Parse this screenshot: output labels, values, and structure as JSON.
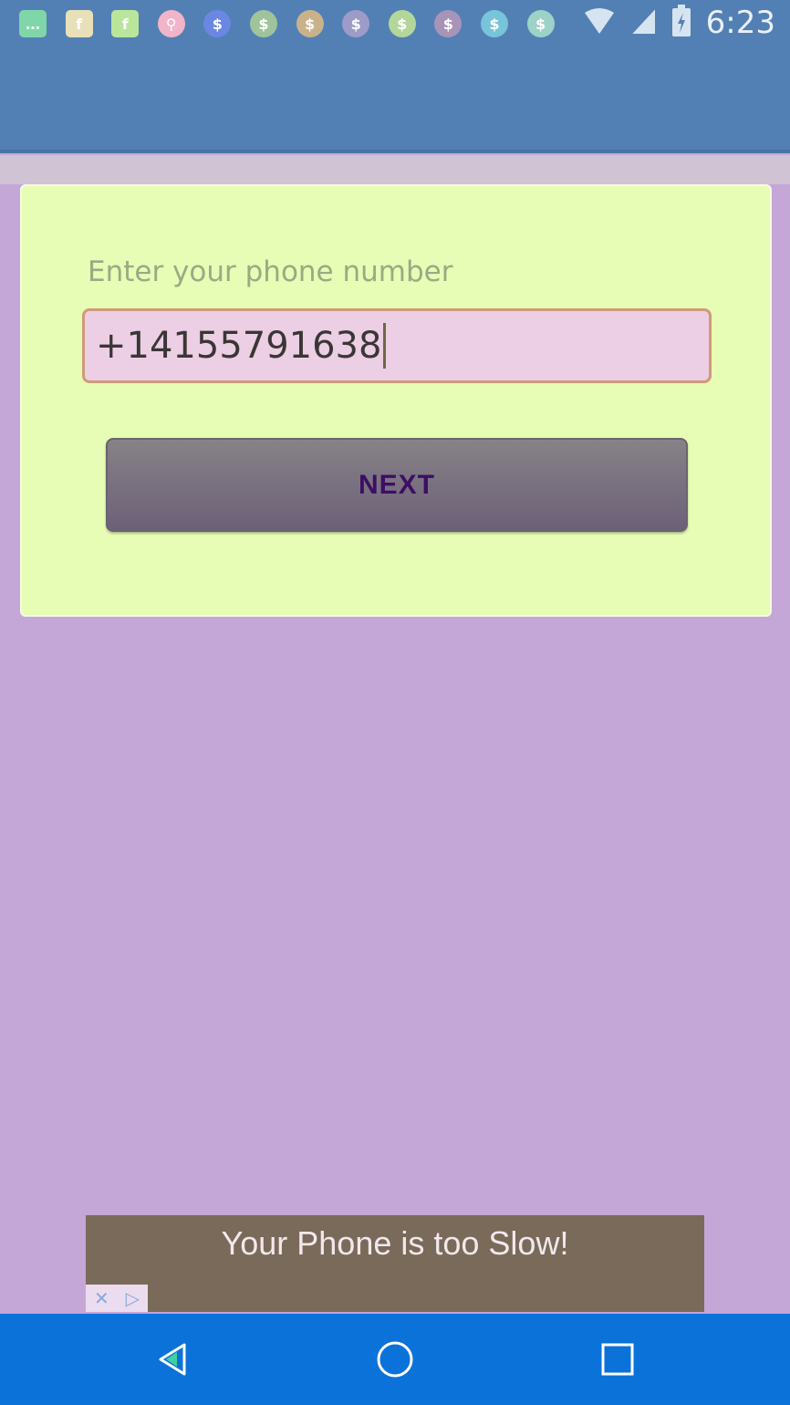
{
  "status_bar": {
    "time": "6:23",
    "notification_icons": [
      {
        "name": "messages-icon",
        "bg": "#7fd6a8"
      },
      {
        "name": "facebook-icon",
        "bg": "#e8e0b8"
      },
      {
        "name": "facebook-icon",
        "bg": "#b9e69a"
      },
      {
        "name": "keyhole-icon",
        "bg": "#f2b4c8"
      },
      {
        "name": "coin-icon",
        "bg": "#6a87e3"
      },
      {
        "name": "coin-icon",
        "bg": "#9fc49a"
      },
      {
        "name": "coin-icon",
        "bg": "#c9b28a"
      },
      {
        "name": "coin-icon",
        "bg": "#9e9bc8"
      },
      {
        "name": "coin-icon",
        "bg": "#b3d79a"
      },
      {
        "name": "coin-icon",
        "bg": "#a894b8"
      },
      {
        "name": "coin-icon",
        "bg": "#78c4d8"
      },
      {
        "name": "coin-icon",
        "bg": "#9cd2c8"
      }
    ],
    "system_icons": [
      "wifi-icon",
      "signal-icon",
      "battery-icon"
    ]
  },
  "phone_form": {
    "label": "Enter your phone number",
    "phone_value": "+14155791638",
    "next_label": "NEXT"
  },
  "ad": {
    "text": "Your Phone is too Slow!",
    "close_glyph": "✕",
    "adchoices_glyph": "▷"
  },
  "nav_bar": {
    "buttons": [
      "back-icon",
      "home-icon",
      "recents-icon"
    ]
  },
  "colors": {
    "status_bar": "#5380b4",
    "background": "#c4a6d7",
    "card": "#e7fcb4",
    "input": "#eccfe4",
    "next_text": "#3d0e64",
    "nav_bar": "#0b72d9"
  }
}
